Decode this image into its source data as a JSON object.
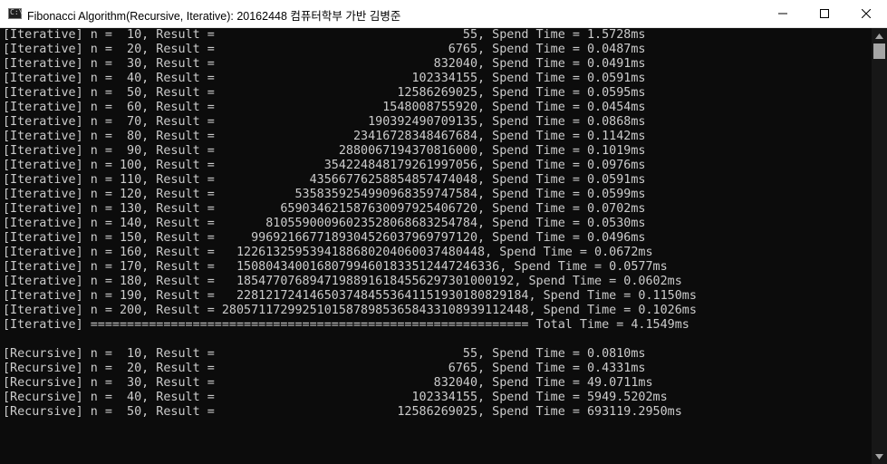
{
  "window": {
    "icon_text": "C:\\",
    "title": "Fibonacci Algorithm(Recursive, Iterative): 20162448 컴퓨터학부 가반 김병준"
  },
  "console": {
    "lines": [
      "[Iterative] n =  10, Result =                                  55, Spend Time = 1.5728ms",
      "[Iterative] n =  20, Result =                                6765, Spend Time = 0.0487ms",
      "[Iterative] n =  30, Result =                              832040, Spend Time = 0.0491ms",
      "[Iterative] n =  40, Result =                           102334155, Spend Time = 0.0591ms",
      "[Iterative] n =  50, Result =                         12586269025, Spend Time = 0.0595ms",
      "[Iterative] n =  60, Result =                       1548008755920, Spend Time = 0.0454ms",
      "[Iterative] n =  70, Result =                     190392490709135, Spend Time = 0.0868ms",
      "[Iterative] n =  80, Result =                   23416728348467684, Spend Time = 0.1142ms",
      "[Iterative] n =  90, Result =                 2880067194370816000, Spend Time = 0.1019ms",
      "[Iterative] n = 100, Result =               354224848179261997056, Spend Time = 0.0976ms",
      "[Iterative] n = 110, Result =             43566776258854857474048, Spend Time = 0.0591ms",
      "[Iterative] n = 120, Result =           5358359254990968359747584, Spend Time = 0.0599ms",
      "[Iterative] n = 130, Result =         659034621587630097925406720, Spend Time = 0.0702ms",
      "[Iterative] n = 140, Result =       81055900096023528068683254784, Spend Time = 0.0530ms",
      "[Iterative] n = 150, Result =     9969216677189304526037969797120, Spend Time = 0.0496ms",
      "[Iterative] n = 160, Result =   1226132595394188680204060037480448, Spend Time = 0.0672ms",
      "[Iterative] n = 170, Result =   150804340016807994601833512447246336, Spend Time = 0.0577ms",
      "[Iterative] n = 180, Result =   18547707689471988916184556297301000192, Spend Time = 0.0602ms",
      "[Iterative] n = 190, Result =   2281217241465037484553641151930180829184, Spend Time = 0.1150ms",
      "[Iterative] n = 200, Result = 280571172992510158789853658433108939112448, Spend Time = 0.1026ms",
      "[Iterative] ============================================================ Total Time = 4.1549ms",
      "",
      "[Recursive] n =  10, Result =                                  55, Spend Time = 0.0810ms",
      "[Recursive] n =  20, Result =                                6765, Spend Time = 0.4331ms",
      "[Recursive] n =  30, Result =                              832040, Spend Time = 49.0711ms",
      "[Recursive] n =  40, Result =                           102334155, Spend Time = 5949.5202ms",
      "[Recursive] n =  50, Result =                         12586269025, Spend Time = 693119.2950ms"
    ]
  }
}
